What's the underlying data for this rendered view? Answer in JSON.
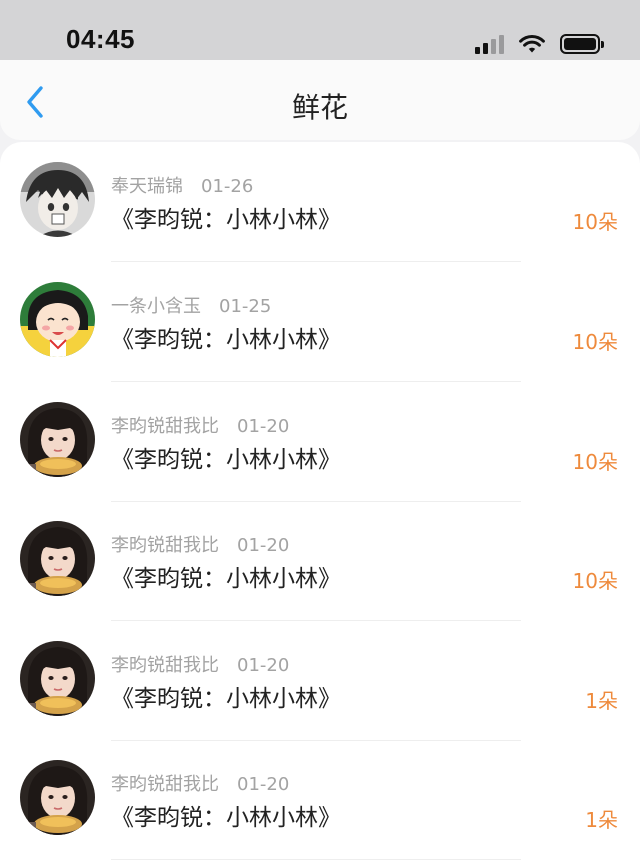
{
  "status_bar": {
    "time": "04:45",
    "icons": [
      "signal-icon",
      "wifi-icon",
      "battery-icon"
    ]
  },
  "nav": {
    "back_icon": "chevron-left-icon",
    "title": "鲜花"
  },
  "colors": {
    "accent_blue": "#2f9bf0",
    "count_orange": "#ee8a3c",
    "meta_gray": "#a3a3a3"
  },
  "items": [
    {
      "user": "奉天瑞锦",
      "date": "01-26",
      "work": "《李昀锐：小林小林》",
      "count": "10朵",
      "avatar": "anime-boy-avatar"
    },
    {
      "user": "一条小含玉",
      "date": "01-25",
      "work": "《李昀锐：小林小林》",
      "count": "10朵",
      "avatar": "cartoon-girl-avatar"
    },
    {
      "user": "李昀锐甜我比",
      "date": "01-20",
      "work": "《李昀锐：小林小林》",
      "count": "10朵",
      "avatar": "photo-girl-avatar"
    },
    {
      "user": "李昀锐甜我比",
      "date": "01-20",
      "work": "《李昀锐：小林小林》",
      "count": "10朵",
      "avatar": "photo-girl-avatar"
    },
    {
      "user": "李昀锐甜我比",
      "date": "01-20",
      "work": "《李昀锐：小林小林》",
      "count": "1朵",
      "avatar": "photo-girl-avatar"
    },
    {
      "user": "李昀锐甜我比",
      "date": "01-20",
      "work": "《李昀锐：小林小林》",
      "count": "1朵",
      "avatar": "photo-girl-avatar"
    }
  ]
}
